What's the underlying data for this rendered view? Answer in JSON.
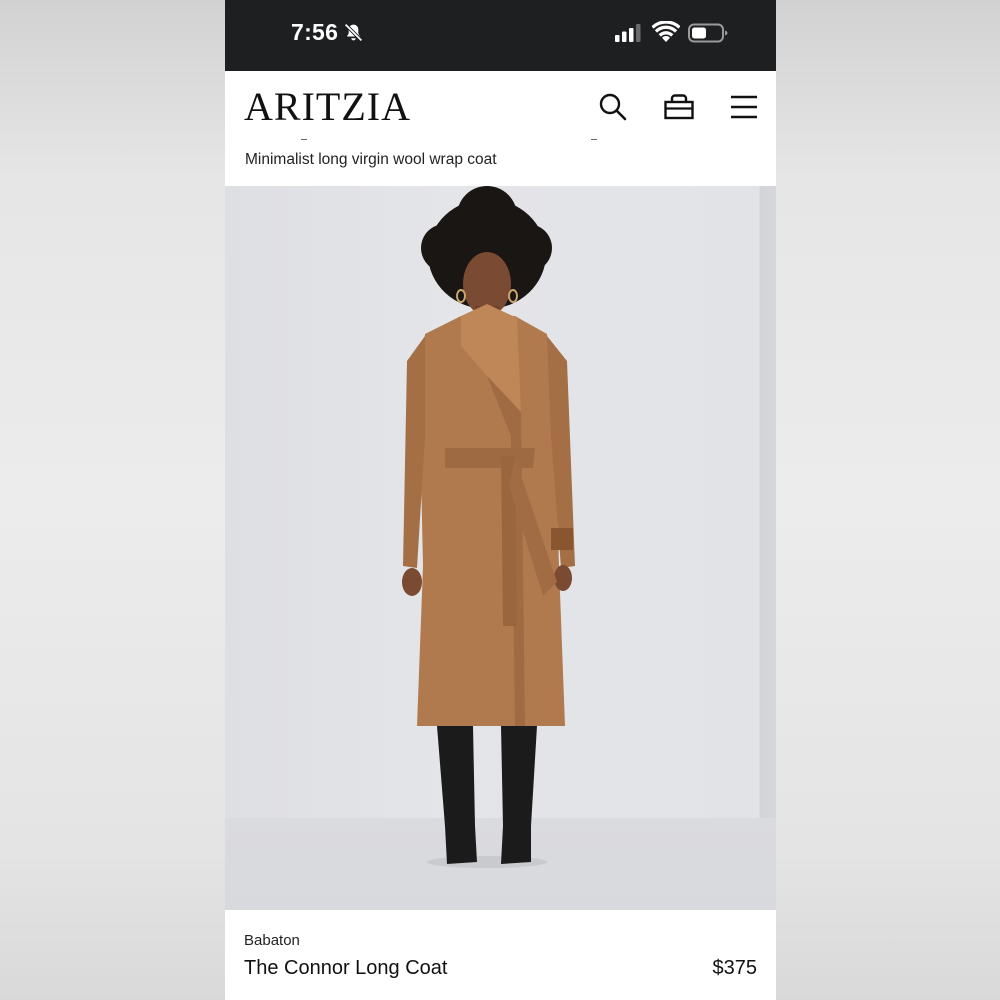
{
  "status_bar": {
    "time": "7:56",
    "icons": [
      "bell-slash-icon",
      "cellular-signal-icon",
      "wifi-icon",
      "battery-icon"
    ]
  },
  "header": {
    "logo": "ARITZIA",
    "icons": [
      "search-icon",
      "shopping-bag-icon",
      "hamburger-menu-icon"
    ],
    "subtitle": "Minimalist long virgin wool wrap coat"
  },
  "hero_image": {
    "subject": "model-in-camel-wrap-coat",
    "coat_color": "#b07a4e"
  },
  "product": {
    "brand": "Babaton",
    "name": "The Connor Long Coat",
    "price": "$375"
  },
  "colors": {
    "status_bar_bg": "#1e1f21",
    "page_bg": "#ffffff",
    "text": "#111111"
  }
}
